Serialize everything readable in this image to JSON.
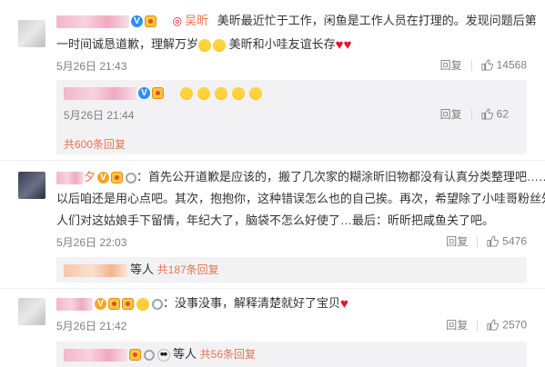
{
  "comments": [
    {
      "author_tag": "吴昕",
      "text_line1": "美昕最近忙于工作，闲鱼是工作人员在打理的。发现问题后第",
      "text_line2_a": "一时间诚恳道歉，理解万岁",
      "text_line2_b": "美昕和小哇友谊长存",
      "date": "5月26日 21:43",
      "reply_label": "回复",
      "likes": "14568",
      "sub": {
        "date": "5月26日 21:44",
        "reply_label": "回复",
        "likes": "62"
      },
      "more_replies": "共600条回复"
    },
    {
      "name_suffix": "夕",
      "text_line1": "：首先公开道歉是应该的，搬了几次家的糊涂昕旧物都没有认真分类整理吧……",
      "text_line2": "以后咱还是用心点吧。其次，抱抱你，这种错误怎么也的自己挨。再次，希望除了小哇哥粉丝外路",
      "text_line3": "人们对这姑娘手下留情，年纪大了，脑袋不怎么好使了…最后：昕昕把咸鱼关了吧。",
      "date": "5月26日 22:03",
      "reply_label": "回复",
      "likes": "5476",
      "sub_text": "等人",
      "more_replies": "共187条回复"
    },
    {
      "text_line1": "：没事没事，解释清楚就好了宝贝",
      "date": "5月26日 21:42",
      "reply_label": "回复",
      "likes": "2570",
      "sub_text": "等人",
      "more_replies": "共56条回复"
    }
  ],
  "colors": {
    "accent": "#eb7350",
    "meta": "#808080",
    "reply_bg": "#f2f2f5",
    "weibo_red": "#e6162d"
  }
}
